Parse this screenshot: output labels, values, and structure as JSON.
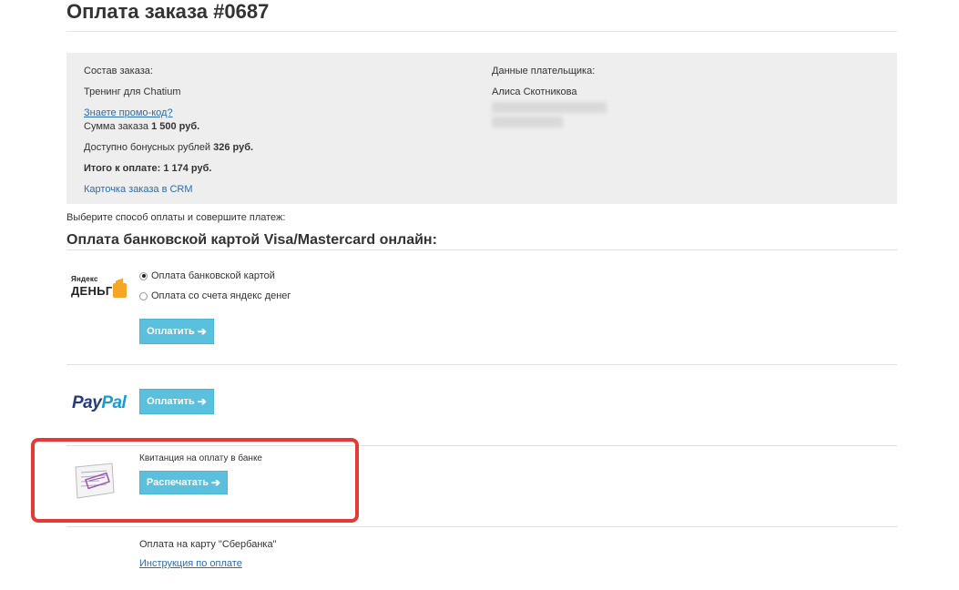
{
  "page": {
    "title": "Оплата заказа #0687"
  },
  "order": {
    "composition_label": "Состав заказа:",
    "product": "Тренинг для Chatium",
    "promo_link": "Знаете промо-код?",
    "sum_label": "Сумма заказа",
    "sum_value": "1 500 руб.",
    "bonus_label": "Доступно бонусных рублей",
    "bonus_value": "326 руб.",
    "total_label": "Итого к оплате:",
    "total_value": "1 174 руб.",
    "crm_link": "Карточка заказа в CRM"
  },
  "payer": {
    "label": "Данные плательщика:",
    "name": "Алиса Скотникова"
  },
  "payment": {
    "choose_text": "Выберите способ оплаты и совершите платеж:",
    "section_title": "Оплата банковской картой Visa/Mastercard онлайн:",
    "yandex": {
      "logo_small": "Яндекс",
      "logo_big": "ДЕНЬГИ",
      "option_card": "Оплата банковской картой",
      "option_wallet": "Оплата со счета яндекс денег",
      "pay_button": "Оплатить"
    },
    "paypal": {
      "logo_part1": "Pay",
      "logo_part2": "Pal",
      "pay_button": "Оплатить"
    },
    "receipt": {
      "label": "Квитанция на оплату в банке",
      "print_button": "Распечатать"
    },
    "sber": {
      "text": "Оплата на карту \"Сбербанка\"",
      "instruction_link": "Инструкция по оплате"
    }
  },
  "colors": {
    "accent_button": "#5bc0de",
    "link": "#2a6db3",
    "highlight_frame": "#e53935"
  }
}
